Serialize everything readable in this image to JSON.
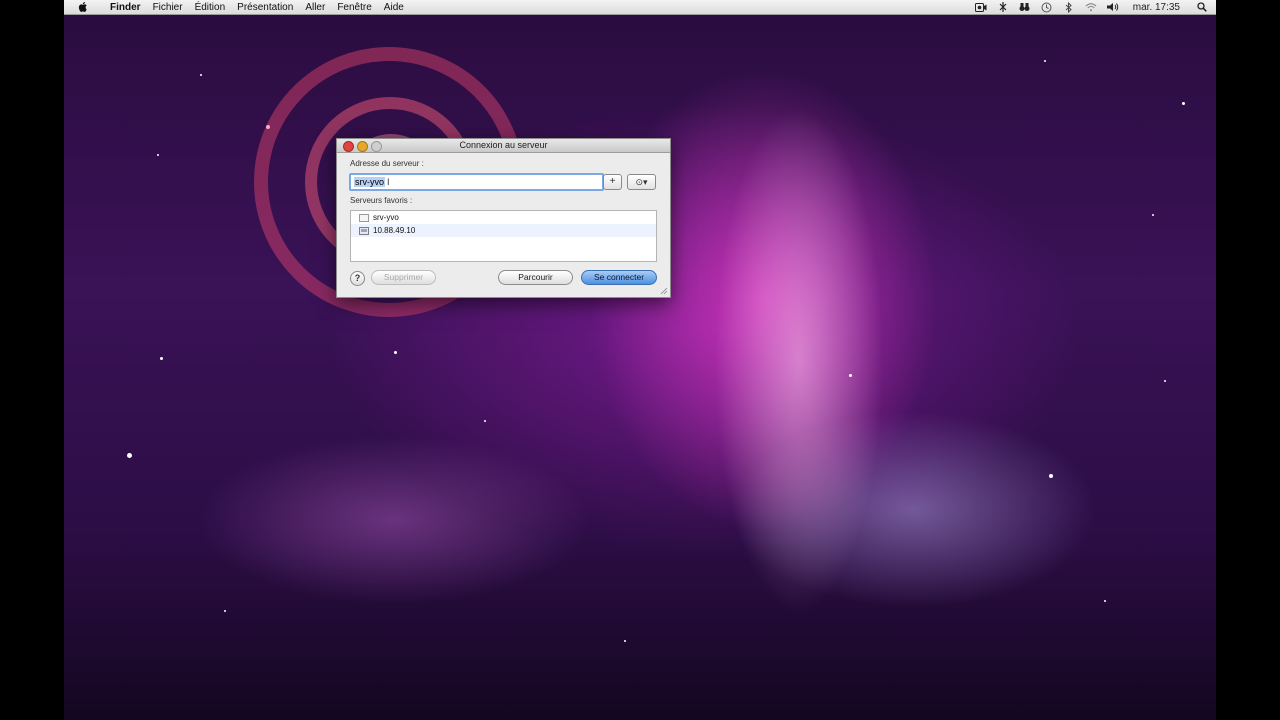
{
  "menubar": {
    "app": "Finder",
    "items": [
      "Fichier",
      "Édition",
      "Présentation",
      "Aller",
      "Fenêtre",
      "Aide"
    ],
    "clock": "mar. 17:35",
    "status_icons": [
      "screen-recorder-icon",
      "bluetooth-sync-icon",
      "binoculars-icon",
      "time-machine-icon",
      "bluetooth-icon",
      "wifi-icon",
      "volume-icon",
      "spotlight-icon"
    ]
  },
  "dialog": {
    "title": "Connexion au serveur",
    "address_label": "Adresse du serveur :",
    "address_value": "srv-yvo",
    "add_button": "+",
    "recent_button": "⊙▾",
    "favorites_label": "Serveurs favoris :",
    "favorites": [
      {
        "name": "srv-yvo"
      },
      {
        "name": "10.88.49.10"
      }
    ],
    "help_label": "?",
    "remove_button": "Supprimer",
    "browse_button": "Parcourir",
    "connect_button": "Se connecter"
  },
  "colors": {
    "accent": "#4d90e0",
    "close": "#e0443e",
    "minimize": "#e5a928",
    "zoom": "#cfcfcf"
  }
}
